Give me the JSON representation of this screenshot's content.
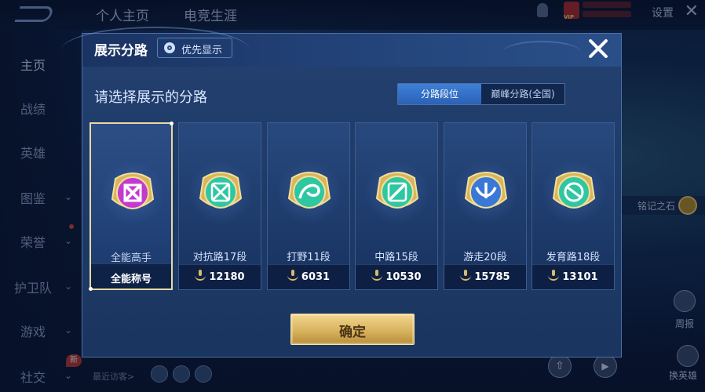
{
  "background": {
    "top_tabs": [
      "个人主页",
      "电竞生涯"
    ],
    "settings_label": "设置",
    "vip_tag": "VIP",
    "sidebar": [
      {
        "label": "主页",
        "active": true
      },
      {
        "label": "战绩"
      },
      {
        "label": "英雄"
      },
      {
        "label": "图鉴",
        "chevron": true
      },
      {
        "label": "荣誉",
        "chevron": true,
        "dot": true
      },
      {
        "label": "护卫队",
        "chevron": true
      },
      {
        "label": "游戏",
        "chevron": true
      },
      {
        "label": "社交",
        "chevron": true
      }
    ],
    "new_badge": "新",
    "recent_visitors": "最近访客>",
    "rune_label": "铭记之石",
    "report_label": "周报",
    "swap_hero_label": "换英雄"
  },
  "dialog": {
    "title": "展示分路",
    "priority_button": "优先显示",
    "subtitle": "请选择展示的分路",
    "segments": [
      {
        "label": "分路段位",
        "active": true
      },
      {
        "label": "巅峰分路(全国)",
        "active": false
      }
    ],
    "cards": [
      {
        "role": "全能高手",
        "bottom": "全能称号",
        "emblem": "all-round-emblem",
        "color": "#c23ad0",
        "selected": true
      },
      {
        "role": "对抗路17段",
        "bottom": "12180",
        "emblem": "clash-lane-emblem",
        "color": "#2fc7a2"
      },
      {
        "role": "打野11段",
        "bottom": "6031",
        "emblem": "jungle-emblem",
        "color": "#2fc7a2"
      },
      {
        "role": "中路15段",
        "bottom": "10530",
        "emblem": "mid-lane-emblem",
        "color": "#2fc7a2"
      },
      {
        "role": "游走20段",
        "bottom": "15785",
        "emblem": "roam-emblem",
        "color": "#3a78d8"
      },
      {
        "role": "发育路18段",
        "bottom": "13101",
        "emblem": "farm-lane-emblem",
        "color": "#2fc7a2"
      }
    ],
    "confirm_button": "确定",
    "colors": {
      "gold": "#d9b35e",
      "selected_border": "#e9d9a2",
      "tab_active": "#3f80d8"
    }
  }
}
